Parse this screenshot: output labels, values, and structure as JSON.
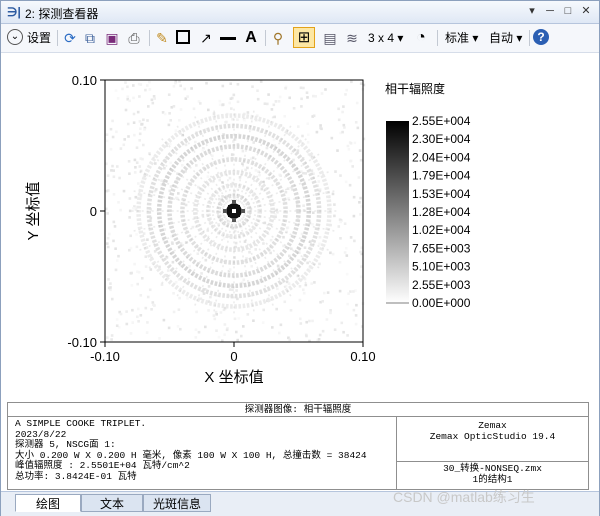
{
  "window": {
    "title": "2: 探测查看器",
    "controls": [
      "▾",
      "─",
      "□",
      "✕"
    ]
  },
  "toolbar": {
    "settings_label": "设置",
    "layout_label": "3 x 4",
    "standard_label": "标准",
    "auto_label": "自动"
  },
  "chart_data": {
    "type": "heatmap",
    "title": "相干辐照度",
    "xlabel": "X 坐标值",
    "ylabel": "Y 坐标值",
    "xlim": [
      -0.1,
      0.1
    ],
    "ylim": [
      -0.1,
      0.1
    ],
    "x_ticks": [
      "-0.10",
      "0",
      "0.10"
    ],
    "y_ticks": [
      "0.10",
      "0",
      "-0.10"
    ],
    "colorbar": {
      "min": 0,
      "max": 25501,
      "labels": [
        "2.55E+004",
        "2.30E+004",
        "2.04E+004",
        "1.79E+004",
        "1.53E+004",
        "1.28E+004",
        "1.02E+004",
        "7.65E+003",
        "5.10E+003",
        "2.55E+003",
        "0.00E+000"
      ]
    },
    "rings": [
      {
        "r": 0.004,
        "v": 0.95
      },
      {
        "r": 0.012,
        "v": 0.12
      },
      {
        "r": 0.02,
        "v": 0.09
      },
      {
        "r": 0.03,
        "v": 0.1
      },
      {
        "r": 0.04,
        "v": 0.12
      },
      {
        "r": 0.05,
        "v": 0.14
      },
      {
        "r": 0.058,
        "v": 0.16
      },
      {
        "r": 0.066,
        "v": 0.12
      },
      {
        "r": 0.074,
        "v": 0.08
      }
    ]
  },
  "info": {
    "header": "探测器图像: 相干辐照度",
    "line1": "A SIMPLE COOKE TRIPLET.",
    "line2": "2023/8/22",
    "line3": "探测器 5, NSCG面 1:",
    "line4": "大小 0.200 W X 0.200 H 毫米, 像素 100 W X 100 H, 总撞击数 = 38424",
    "line5": "峰值辐照度 : 2.5501E+04 瓦特/cm^2",
    "line6": "总功率: 3.8424E-01 瓦特",
    "right_line1": "Zemax",
    "right_line2": "Zemax OpticStudio 19.4",
    "right_line3": "30_转换-NONSEQ.zmx",
    "right_line4": "1的结构1"
  },
  "tabs": [
    "绘图",
    "文本",
    "光斑信息"
  ],
  "watermark": "CSDN @matlab练习生"
}
